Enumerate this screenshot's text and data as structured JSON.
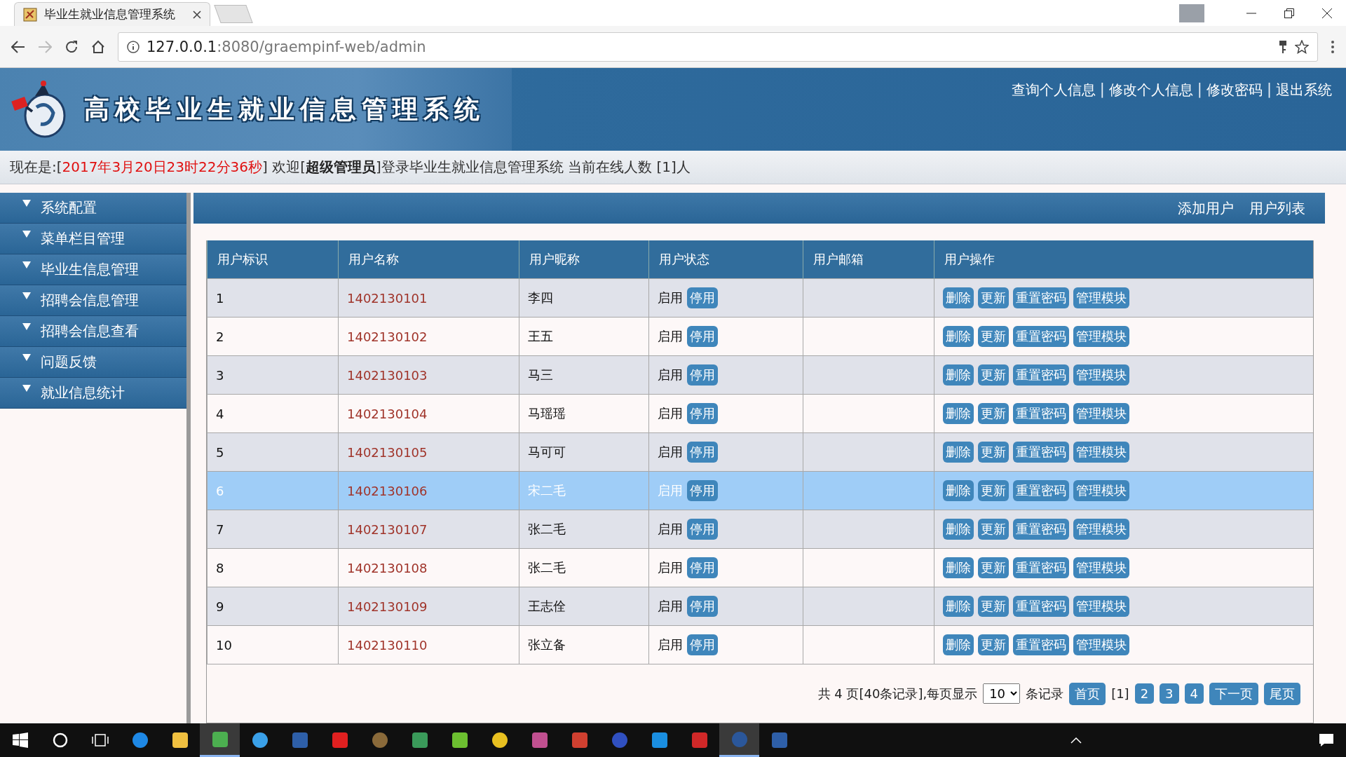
{
  "browser": {
    "tab_title": "毕业生就业信息管理系统",
    "url_host": "127.0.0.1",
    "url_rest": ":8080/graempinf-web/admin"
  },
  "header": {
    "title": "高校毕业生就业信息管理系统",
    "links": [
      {
        "kind": "link",
        "text": "查询个人信息"
      },
      {
        "kind": "separator",
        "text": "|"
      },
      {
        "kind": "link",
        "text": "修改个人信息"
      },
      {
        "kind": "separator",
        "text": "|"
      },
      {
        "kind": "link",
        "text": "修改密码"
      },
      {
        "kind": "separator",
        "text": "|"
      },
      {
        "kind": "link",
        "text": "退出系统"
      }
    ]
  },
  "status": {
    "prefix": "现在是:[",
    "time": "2017年3月20日23时22分36秒",
    "message": "] 欢迎[**超级管理员**]登录毕业生就业信息管理系统 当前在线人数 [1]人"
  },
  "sidebar": {
    "items": [
      "系统配置",
      "菜单栏目管理",
      "毕业生信息管理",
      "招聘会信息管理",
      "招聘会信息查看",
      "问题反馈",
      "就业信息统计"
    ]
  },
  "toolbar": {
    "links": [
      "添加用户",
      "用户列表"
    ]
  },
  "table": {
    "columns": [
      "用户标识",
      "用户名称",
      "用户昵称",
      "用户状态",
      "用户邮箱",
      "用户操作"
    ],
    "rows": [
      {
        "id": "1",
        "username": "1402130101",
        "nickname": "李四",
        "status": "启用",
        "toggle": "停用",
        "actions": [
          "删除",
          "更新",
          "重置密码",
          "管理模块"
        ],
        "selected": false
      },
      {
        "id": "2",
        "username": "1402130102",
        "nickname": "王五",
        "status": "启用",
        "toggle": "停用",
        "actions": [
          "删除",
          "更新",
          "重置密码",
          "管理模块"
        ],
        "selected": false
      },
      {
        "id": "3",
        "username": "1402130103",
        "nickname": "马三",
        "status": "启用",
        "toggle": "停用",
        "actions": [
          "删除",
          "更新",
          "重置密码",
          "管理模块"
        ],
        "selected": false
      },
      {
        "id": "4",
        "username": "1402130104",
        "nickname": "马瑶瑶",
        "status": "启用",
        "toggle": "停用",
        "actions": [
          "删除",
          "更新",
          "重置密码",
          "管理模块"
        ],
        "selected": false
      },
      {
        "id": "5",
        "username": "1402130105",
        "nickname": "马可可",
        "status": "启用",
        "toggle": "停用",
        "actions": [
          "删除",
          "更新",
          "重置密码",
          "管理模块"
        ],
        "selected": false
      },
      {
        "id": "6",
        "username": "1402130106",
        "nickname": "宋二毛",
        "status": "启用",
        "toggle": "停用",
        "actions": [
          "删除",
          "更新",
          "重置密码",
          "管理模块"
        ],
        "selected": true
      },
      {
        "id": "7",
        "username": "1402130107",
        "nickname": "张二毛",
        "status": "启用",
        "toggle": "停用",
        "actions": [
          "删除",
          "更新",
          "重置密码",
          "管理模块"
        ],
        "selected": false
      },
      {
        "id": "8",
        "username": "1402130108",
        "nickname": "张二毛",
        "status": "启用",
        "toggle": "停用",
        "actions": [
          "删除",
          "更新",
          "重置密码",
          "管理模块"
        ],
        "selected": false
      },
      {
        "id": "9",
        "username": "1402130109",
        "nickname": "王志佺",
        "status": "启用",
        "toggle": "停用",
        "actions": [
          "删除",
          "更新",
          "重置密码",
          "管理模块"
        ],
        "selected": false
      },
      {
        "id": "10",
        "username": "1402130110",
        "nickname": "张立备",
        "status": "启用",
        "toggle": "停用",
        "actions": [
          "删除",
          "更新",
          "重置密码",
          "管理模块"
        ],
        "selected": false
      }
    ]
  },
  "pager": {
    "summary": "共 4 页[40条记录],每页显示",
    "page_size": "10",
    "unit": "条记录",
    "items": [
      {
        "kind": "button",
        "text": "首页"
      },
      {
        "kind": "current",
        "text": "[1]"
      },
      {
        "kind": "button",
        "text": "2"
      },
      {
        "kind": "button",
        "text": "3"
      },
      {
        "kind": "button",
        "text": "4"
      },
      {
        "kind": "button",
        "text": "下一页"
      },
      {
        "kind": "button",
        "text": "尾页"
      }
    ]
  },
  "taskbar": {
    "apps": [
      {
        "color": "#1e88e5",
        "selected": false
      },
      {
        "color": "#f0c040",
        "selected": false
      },
      {
        "color": "#4caf50",
        "selected": true
      },
      {
        "color": "#3aa0e8",
        "selected": false
      },
      {
        "color": "#2e5fa8",
        "selected": false
      },
      {
        "color": "#e02020",
        "selected": false
      },
      {
        "color": "#8a6a3a",
        "selected": false
      },
      {
        "color": "#3a9a5a",
        "selected": false
      },
      {
        "color": "#6cbf30",
        "selected": false
      },
      {
        "color": "#e8c020",
        "selected": false
      },
      {
        "color": "#c05090",
        "selected": false
      },
      {
        "color": "#d04030",
        "selected": false
      },
      {
        "color": "#3050c0",
        "selected": false
      },
      {
        "color": "#1a8ee0",
        "selected": false
      },
      {
        "color": "#d02828",
        "selected": false
      },
      {
        "color": "#2b579a",
        "selected": true
      },
      {
        "color": "#2e5fa8",
        "selected": false
      }
    ]
  }
}
